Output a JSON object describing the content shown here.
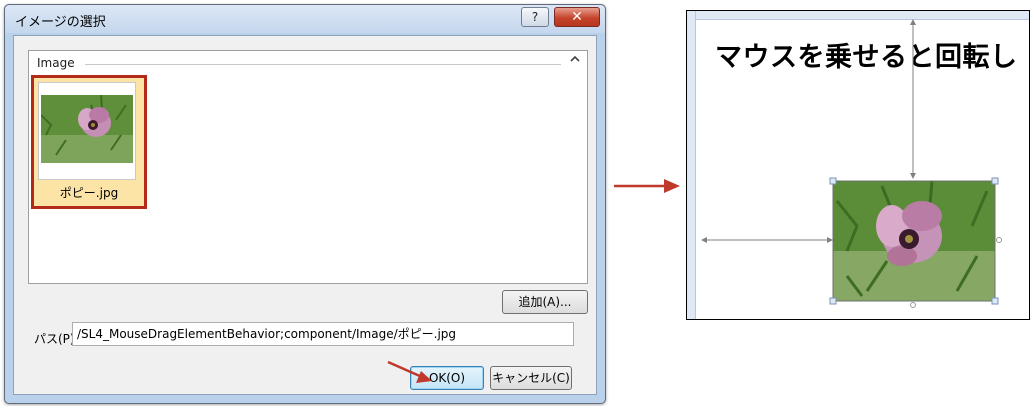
{
  "dialog": {
    "title": "イメージの選択",
    "help_label": "?",
    "close_label": "✕",
    "section_label": "Image",
    "collapse_icon": "chevron-up-icon",
    "image_item": {
      "caption": "ポピー.jpg",
      "selected": true
    },
    "add_button_label": "追加(A)...",
    "path_label": "パス(P)",
    "path_value": "/SL4_MouseDragElementBehavior;component/Image/ポピー.jpg",
    "ok_label": "OK(O)",
    "cancel_label": "キャンセル(C)"
  },
  "designer": {
    "heading": "マウスを乗せると回転し"
  },
  "colors": {
    "highlight_border": "#b22a1a",
    "selection_fill": "#fce4a6",
    "arrow": "#c0392b",
    "dialog_frame": "#b9d1ea"
  }
}
